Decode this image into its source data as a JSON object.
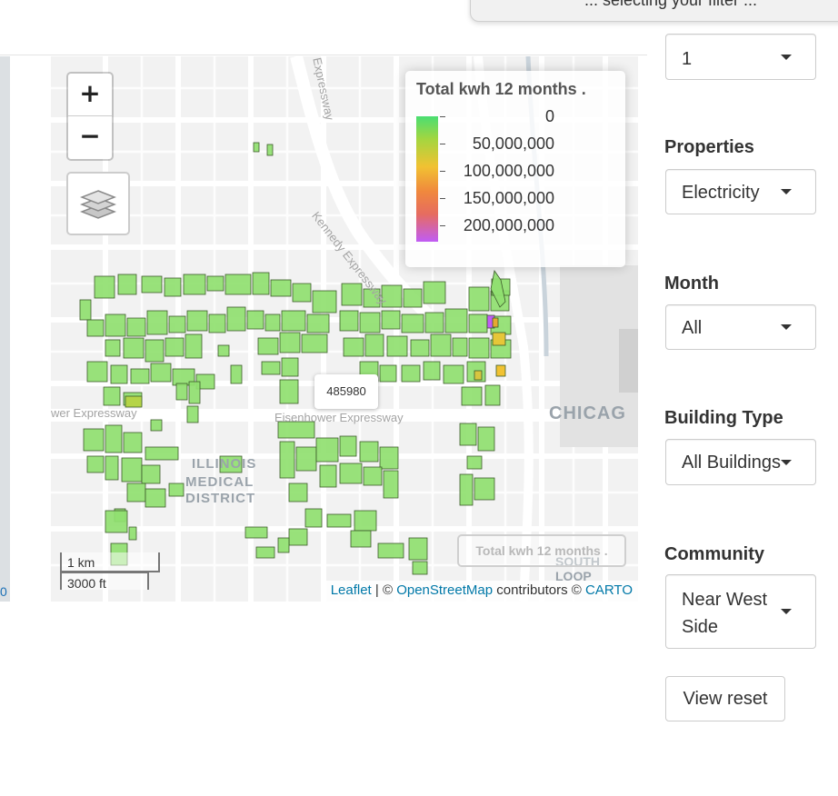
{
  "tooltip_text": "... selecting your filter ...",
  "left_strip_mark": "0",
  "map": {
    "zoom_in": "+",
    "zoom_out": "−",
    "legend": {
      "title": "Total kwh 12 months .",
      "labels": [
        "0",
        "50,000,000",
        "100,000,000",
        "150,000,000",
        "200,000,000"
      ]
    },
    "labels": {
      "chicago": "CHICAG",
      "illinois1": "ILLINOIS",
      "illinois2": "MEDICAL",
      "illinois3": "DISTRICT",
      "eisenhower": "Eisenhower Expressway",
      "eisenhower_left": "wer Expressway",
      "kennedy": "Kennedy Expressway",
      "expressway_top": "Expressway",
      "south_loop": "SOUTH LOOP"
    },
    "popup_value": "485980",
    "ghost_legend": "Total kwh 12 months .",
    "scale": {
      "km": "1 km",
      "ft": "3000 ft"
    },
    "attribution": {
      "leaflet": "Leaflet",
      "sep": " | © ",
      "osm": "OpenStreetMap",
      "contrib": " contributors © ",
      "carto": "CARTO"
    },
    "colors": {
      "building": "#90e070",
      "building_stroke": "#3c5a2a",
      "road": "#ffffff",
      "block": "#e6e6e6"
    }
  },
  "sidebar": {
    "top_select": {
      "value": "1"
    },
    "properties": {
      "label": "Properties",
      "value": "Electricity"
    },
    "month": {
      "label": "Month",
      "value": "All"
    },
    "building_type": {
      "label": "Building Type",
      "value": "All Buildings"
    },
    "community": {
      "label": "Community",
      "value": "Near West Side"
    },
    "reset_button": "View reset"
  }
}
